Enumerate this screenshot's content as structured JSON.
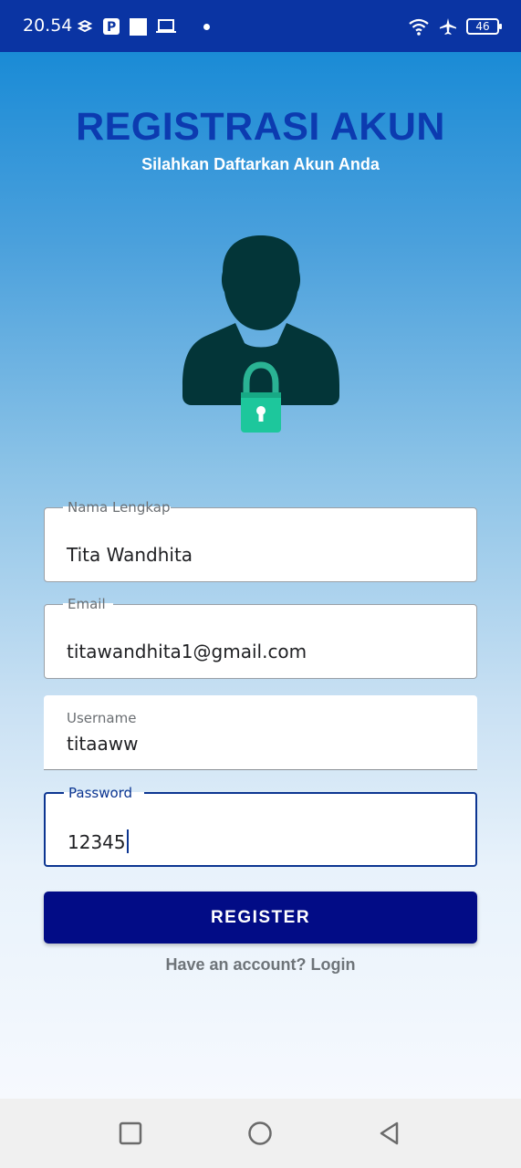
{
  "status_bar": {
    "time": "20.54",
    "battery": "46",
    "left_icons": [
      "signal-off-icon",
      "parking-icon",
      "square-icon",
      "laptop-icon",
      "dot-icon"
    ],
    "right_icons": [
      "wifi-icon",
      "airplane-icon",
      "battery-icon"
    ],
    "color": "#0a34a3"
  },
  "header": {
    "title": "REGISTRASI AKUN",
    "subtitle": "Silahkan Daftarkan Akun Anda",
    "title_color": "#0c3bb0"
  },
  "form": {
    "full_name": {
      "label": "Nama Lengkap",
      "value": "Tita Wandhita"
    },
    "email": {
      "label": "Email",
      "value": "titawandhita1@gmail.com"
    },
    "username": {
      "label": "Username",
      "value": "titaaww"
    },
    "password": {
      "label": "Password",
      "value": "12345"
    }
  },
  "register_button": {
    "label": "REGISTER",
    "color": "#020c86"
  },
  "login_link": "Have an account? Login",
  "nav_bar": {
    "icons": [
      "recents-square-icon",
      "home-circle-icon",
      "back-triangle-icon"
    ]
  }
}
